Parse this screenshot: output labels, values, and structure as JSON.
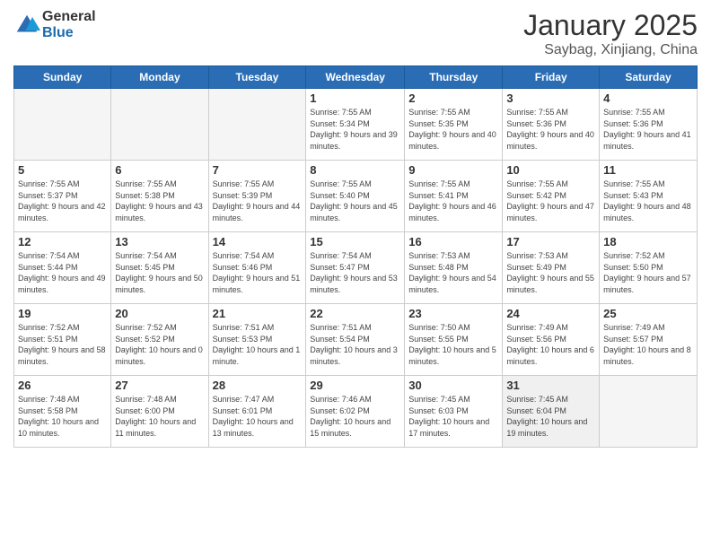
{
  "header": {
    "logo_general": "General",
    "logo_blue": "Blue",
    "month_title": "January 2025",
    "subtitle": "Saybag, Xinjiang, China"
  },
  "weekdays": [
    "Sunday",
    "Monday",
    "Tuesday",
    "Wednesday",
    "Thursday",
    "Friday",
    "Saturday"
  ],
  "weeks": [
    [
      {
        "day": "",
        "empty": true
      },
      {
        "day": "",
        "empty": true
      },
      {
        "day": "",
        "empty": true
      },
      {
        "day": "1",
        "sunrise": "7:55 AM",
        "sunset": "5:34 PM",
        "daylight": "9 hours and 39 minutes."
      },
      {
        "day": "2",
        "sunrise": "7:55 AM",
        "sunset": "5:35 PM",
        "daylight": "9 hours and 40 minutes."
      },
      {
        "day": "3",
        "sunrise": "7:55 AM",
        "sunset": "5:36 PM",
        "daylight": "9 hours and 40 minutes."
      },
      {
        "day": "4",
        "sunrise": "7:55 AM",
        "sunset": "5:36 PM",
        "daylight": "9 hours and 41 minutes."
      }
    ],
    [
      {
        "day": "5",
        "sunrise": "7:55 AM",
        "sunset": "5:37 PM",
        "daylight": "9 hours and 42 minutes."
      },
      {
        "day": "6",
        "sunrise": "7:55 AM",
        "sunset": "5:38 PM",
        "daylight": "9 hours and 43 minutes."
      },
      {
        "day": "7",
        "sunrise": "7:55 AM",
        "sunset": "5:39 PM",
        "daylight": "9 hours and 44 minutes."
      },
      {
        "day": "8",
        "sunrise": "7:55 AM",
        "sunset": "5:40 PM",
        "daylight": "9 hours and 45 minutes."
      },
      {
        "day": "9",
        "sunrise": "7:55 AM",
        "sunset": "5:41 PM",
        "daylight": "9 hours and 46 minutes."
      },
      {
        "day": "10",
        "sunrise": "7:55 AM",
        "sunset": "5:42 PM",
        "daylight": "9 hours and 47 minutes."
      },
      {
        "day": "11",
        "sunrise": "7:55 AM",
        "sunset": "5:43 PM",
        "daylight": "9 hours and 48 minutes."
      }
    ],
    [
      {
        "day": "12",
        "sunrise": "7:54 AM",
        "sunset": "5:44 PM",
        "daylight": "9 hours and 49 minutes."
      },
      {
        "day": "13",
        "sunrise": "7:54 AM",
        "sunset": "5:45 PM",
        "daylight": "9 hours and 50 minutes."
      },
      {
        "day": "14",
        "sunrise": "7:54 AM",
        "sunset": "5:46 PM",
        "daylight": "9 hours and 51 minutes."
      },
      {
        "day": "15",
        "sunrise": "7:54 AM",
        "sunset": "5:47 PM",
        "daylight": "9 hours and 53 minutes."
      },
      {
        "day": "16",
        "sunrise": "7:53 AM",
        "sunset": "5:48 PM",
        "daylight": "9 hours and 54 minutes."
      },
      {
        "day": "17",
        "sunrise": "7:53 AM",
        "sunset": "5:49 PM",
        "daylight": "9 hours and 55 minutes."
      },
      {
        "day": "18",
        "sunrise": "7:52 AM",
        "sunset": "5:50 PM",
        "daylight": "9 hours and 57 minutes."
      }
    ],
    [
      {
        "day": "19",
        "sunrise": "7:52 AM",
        "sunset": "5:51 PM",
        "daylight": "9 hours and 58 minutes."
      },
      {
        "day": "20",
        "sunrise": "7:52 AM",
        "sunset": "5:52 PM",
        "daylight": "10 hours and 0 minutes."
      },
      {
        "day": "21",
        "sunrise": "7:51 AM",
        "sunset": "5:53 PM",
        "daylight": "10 hours and 1 minute."
      },
      {
        "day": "22",
        "sunrise": "7:51 AM",
        "sunset": "5:54 PM",
        "daylight": "10 hours and 3 minutes."
      },
      {
        "day": "23",
        "sunrise": "7:50 AM",
        "sunset": "5:55 PM",
        "daylight": "10 hours and 5 minutes."
      },
      {
        "day": "24",
        "sunrise": "7:49 AM",
        "sunset": "5:56 PM",
        "daylight": "10 hours and 6 minutes."
      },
      {
        "day": "25",
        "sunrise": "7:49 AM",
        "sunset": "5:57 PM",
        "daylight": "10 hours and 8 minutes."
      }
    ],
    [
      {
        "day": "26",
        "sunrise": "7:48 AM",
        "sunset": "5:58 PM",
        "daylight": "10 hours and 10 minutes."
      },
      {
        "day": "27",
        "sunrise": "7:48 AM",
        "sunset": "6:00 PM",
        "daylight": "10 hours and 11 minutes."
      },
      {
        "day": "28",
        "sunrise": "7:47 AM",
        "sunset": "6:01 PM",
        "daylight": "10 hours and 13 minutes."
      },
      {
        "day": "29",
        "sunrise": "7:46 AM",
        "sunset": "6:02 PM",
        "daylight": "10 hours and 15 minutes."
      },
      {
        "day": "30",
        "sunrise": "7:45 AM",
        "sunset": "6:03 PM",
        "daylight": "10 hours and 17 minutes."
      },
      {
        "day": "31",
        "sunrise": "7:45 AM",
        "sunset": "6:04 PM",
        "daylight": "10 hours and 19 minutes."
      },
      {
        "day": "",
        "empty": true
      }
    ]
  ]
}
